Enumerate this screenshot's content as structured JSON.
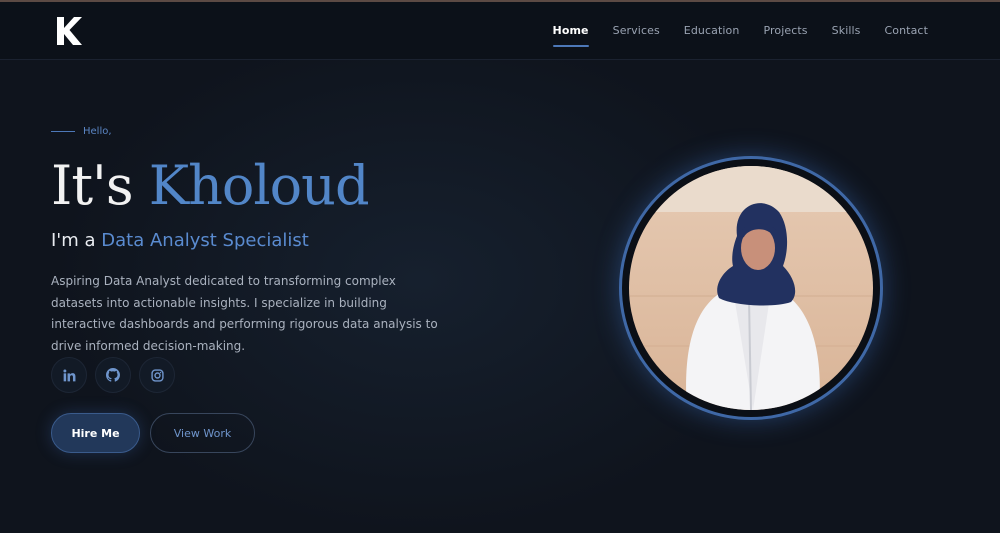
{
  "nav": {
    "logo_letter": "K",
    "links": [
      "Home",
      "Services",
      "Education",
      "Projects",
      "Skills",
      "Contact"
    ],
    "active": "Home"
  },
  "hero": {
    "greeting": "Hello,",
    "headline_prefix": "It's ",
    "name": "Kholoud",
    "subhead_prefix": "I'm a ",
    "role": "Data Analyst Specialist",
    "description": "Aspiring Data Analyst dedicated to transforming complex datasets into actionable insights. I specialize in building interactive dashboards and performing rigorous data analysis to drive informed decision-making.",
    "socials": [
      "linkedin-icon",
      "github-icon",
      "instagram-icon"
    ],
    "primary_button": "Hire Me",
    "secondary_button": "View Work"
  },
  "colors": {
    "accent": "#5286c8",
    "background": "#0f141d",
    "navbar": "#0c1119"
  }
}
